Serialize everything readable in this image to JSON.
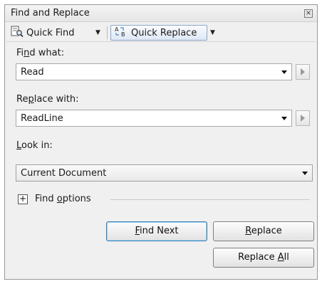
{
  "window": {
    "title": "Find and Replace"
  },
  "toolbar": {
    "quick_find_label": "Quick Find",
    "quick_replace_label": "Quick Replace"
  },
  "find": {
    "label_pre": "Fi",
    "label_u": "n",
    "label_post": "d what:",
    "value": "Read"
  },
  "replace": {
    "label_pre": "Re",
    "label_u": "p",
    "label_post": "lace with:",
    "value": "ReadLine"
  },
  "lookin": {
    "label_u": "L",
    "label_post": "ook in:",
    "value": "Current Document"
  },
  "options": {
    "label_pre": "Find ",
    "label_u": "o",
    "label_post": "ptions"
  },
  "buttons": {
    "find_next_u": "F",
    "find_next_post": "ind Next",
    "replace_u": "R",
    "replace_post": "eplace",
    "replace_all_pre": "Replace ",
    "replace_all_u": "A",
    "replace_all_post": "ll"
  },
  "colors": {
    "accent": "#3c7fb1",
    "window_bg": "#f0f0f0"
  },
  "icons": [
    "close-icon",
    "quick-find-icon",
    "quick-replace-icon",
    "dropdown-arrow-icon",
    "expand-arrow-icon",
    "expand-options-icon"
  ]
}
